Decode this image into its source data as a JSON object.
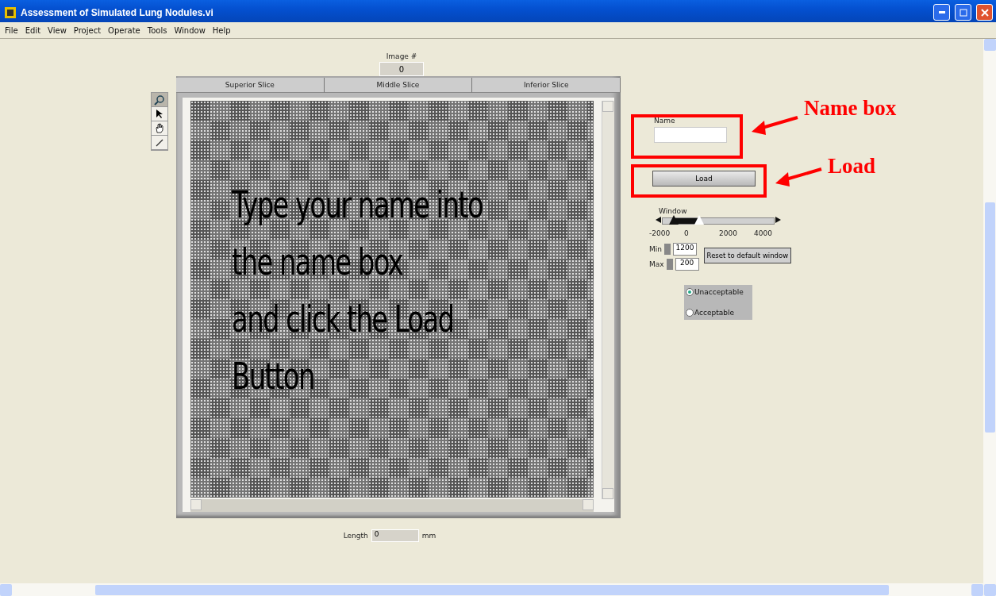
{
  "window": {
    "title": "Assessment of Simulated Lung Nodules.vi"
  },
  "menu": [
    "File",
    "Edit",
    "View",
    "Project",
    "Operate",
    "Tools",
    "Window",
    "Help"
  ],
  "image_number": {
    "label": "Image #",
    "value": "0"
  },
  "tools": [
    {
      "selected": true
    },
    {
      "selected": false
    },
    {
      "selected": false
    },
    {
      "selected": false
    }
  ],
  "slice_headers": [
    "Superior Slice",
    "Middle Slice",
    "Inferior Slice"
  ],
  "image_display": {
    "lines": [
      "Type your name into",
      "the name box",
      "and click the Load",
      "Button"
    ]
  },
  "length": {
    "label": "Length",
    "value": "0",
    "unit": "mm"
  },
  "name_field": {
    "label": "Name"
  },
  "load_button": {
    "label": "Load"
  },
  "window_slider": {
    "label": "Window",
    "thumbs": [
      {
        "level": 0.1
      },
      {
        "level": 0.33
      }
    ],
    "ticks": [
      "-2000",
      "0",
      "2000",
      "4000"
    ]
  },
  "min": {
    "label": "Min",
    "value": "1200"
  },
  "max": {
    "label": "Max",
    "value": "200"
  },
  "reset_button": {
    "label": "Reset to default window"
  },
  "rating": [
    {
      "label": "Unacceptable",
      "selected": true
    },
    {
      "label": "Acceptable",
      "selected": false
    }
  ],
  "callouts": [
    {
      "label": "Name box"
    },
    {
      "label": "Load"
    }
  ]
}
